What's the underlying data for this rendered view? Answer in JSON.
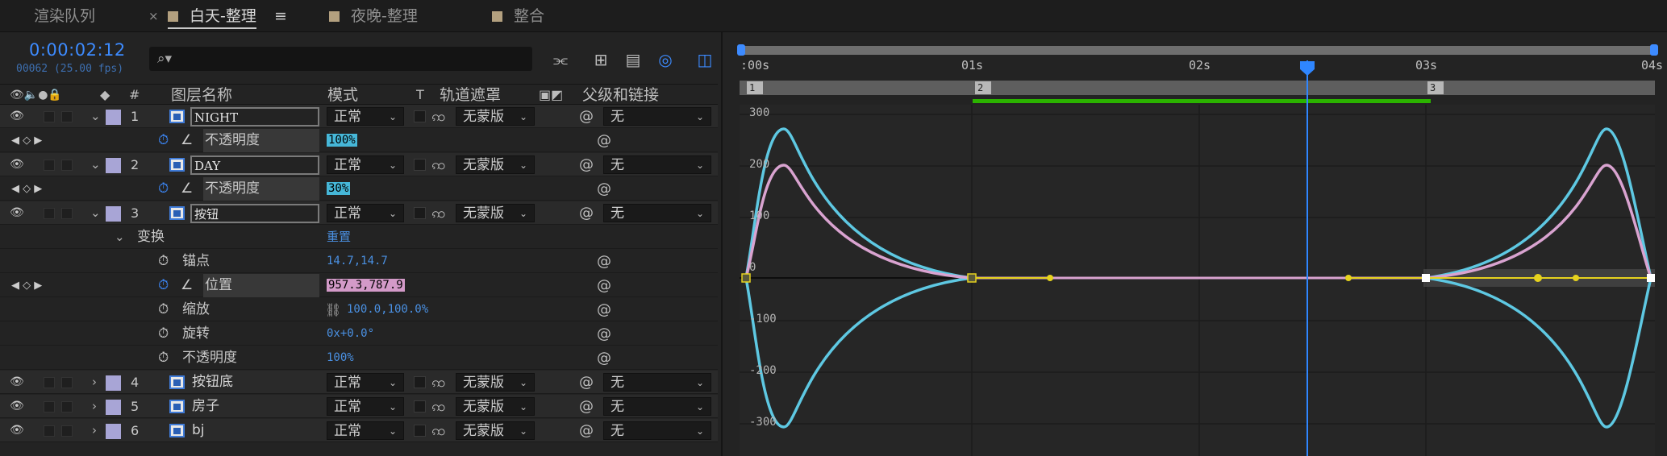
{
  "tabs": {
    "render_queue": "渲染队列",
    "close_mark": "×",
    "day": "白天-整理",
    "day_menu": "≡",
    "night": "夜晚-整理",
    "combine": "整合"
  },
  "timecode": "0:00:02:12",
  "fps": "00062 (25.00 fps)",
  "search": {
    "icon": "⌕▾",
    "placeholder": ""
  },
  "headers": {
    "label_icon": "label-tag-icon",
    "num": "#",
    "name": "图层名称",
    "mode": "模式",
    "t": "T",
    "matte": "轨道遮罩",
    "parent": "父级和链接"
  },
  "layers": [
    {
      "num": "1",
      "name": "NIGHT",
      "mode": "正常",
      "matte": "无蒙版",
      "parent": "无"
    },
    {
      "num": "2",
      "name": "DAY",
      "mode": "正常",
      "matte": "无蒙版",
      "parent": "无"
    },
    {
      "num": "3",
      "name": "按钮",
      "mode": "正常",
      "matte": "无蒙版",
      "parent": "无"
    },
    {
      "num": "4",
      "name": "按钮底",
      "mode": "正常",
      "matte": "无蒙版",
      "parent": "无"
    },
    {
      "num": "5",
      "name": "房子",
      "mode": "正常",
      "matte": "无蒙版",
      "parent": "无"
    },
    {
      "num": "6",
      "name": "bj",
      "mode": "正常",
      "matte": "无蒙版",
      "parent": "无"
    }
  ],
  "props": {
    "opacity1": {
      "name": "不透明度",
      "value": "100%"
    },
    "opacity2": {
      "name": "不透明度",
      "value": "30%"
    },
    "transform": {
      "name": "变换",
      "reset": "重置"
    },
    "anchor": {
      "name": "锚点",
      "value": "14.7,14.7"
    },
    "position": {
      "name": "位置",
      "value": "957.3,787.9"
    },
    "scale": {
      "name": "缩放",
      "value": "100.0,100.0%"
    },
    "rotation": {
      "name": "旋转",
      "value": "0x+0.0°"
    },
    "opacity3": {
      "name": "不透明度",
      "value": "100%"
    }
  },
  "timeline": {
    "labels": [
      ":00s",
      "01s",
      "02s",
      "03s",
      "04s"
    ],
    "markers": [
      "1",
      "2",
      "3"
    ]
  },
  "graph": {
    "y_labels": [
      "300",
      "200",
      "100",
      "0",
      "-100",
      "-200",
      "-300"
    ],
    "colors": {
      "cyan": "#5ec8e2",
      "pink": "#d9a3d0",
      "yellow": "#e6d21e",
      "playhead": "#2f86ff"
    }
  }
}
